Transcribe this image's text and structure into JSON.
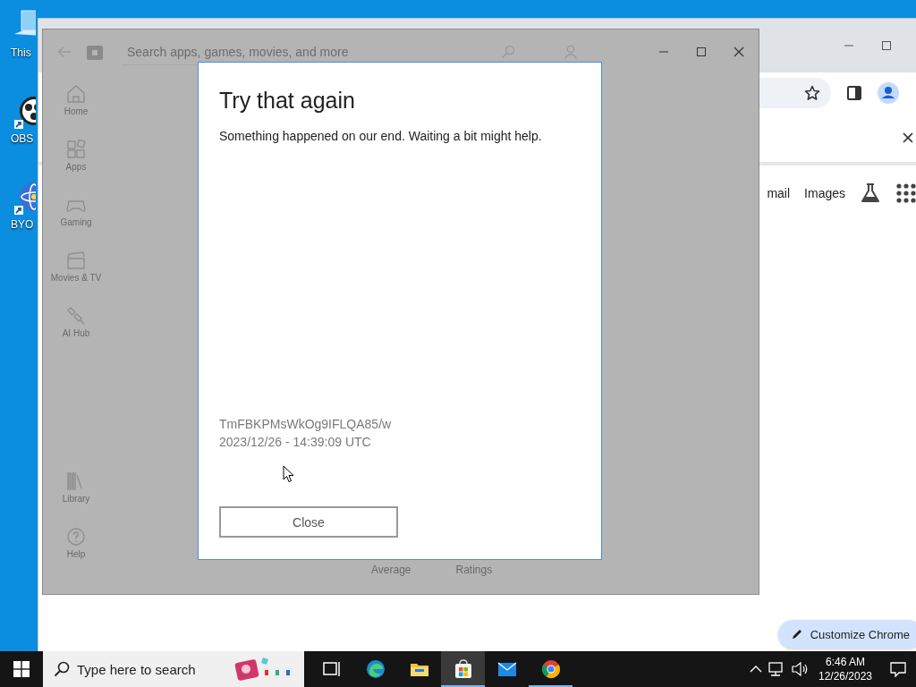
{
  "desktop_icons": [
    {
      "label": "This",
      "kind": "computer"
    },
    {
      "label": "OBS",
      "kind": "obs"
    },
    {
      "label": "BYO",
      "kind": "atom"
    }
  ],
  "browser_window": {
    "links": [
      "mail",
      "Images"
    ],
    "customize_button": "Customize Chrome"
  },
  "store_window": {
    "search": {
      "placeholder": "Search apps, games, movies, and more"
    },
    "nav_items": [
      {
        "label": "Home",
        "kind": "home"
      },
      {
        "label": "Apps",
        "kind": "apps"
      },
      {
        "label": "Gaming",
        "kind": "gaming"
      },
      {
        "label": "Movies & TV",
        "kind": "movies"
      },
      {
        "label": "AI Hub",
        "kind": "ai"
      }
    ],
    "footer_items": [
      {
        "label": "Library",
        "kind": "library"
      },
      {
        "label": "Help",
        "kind": "help"
      }
    ],
    "background_labels": [
      "Average",
      "Ratings"
    ]
  },
  "dialog": {
    "title": "Try that again",
    "message": "Something happened on our end. Waiting a bit might help.",
    "error_code": "TmFBKPMsWkOg9IFLQA85/w",
    "timestamp": "2023/12/26 - 14:39:09 UTC",
    "button": "Close"
  },
  "taskbar": {
    "search": {
      "placeholder": "Type here to search"
    },
    "apps": [
      {
        "kind": "taskview",
        "selected": false,
        "running": false
      },
      {
        "kind": "edge",
        "selected": false,
        "running": false
      },
      {
        "kind": "explorer",
        "selected": false,
        "running": false
      },
      {
        "kind": "store",
        "selected": true,
        "running": true
      },
      {
        "kind": "mail",
        "selected": false,
        "running": false
      },
      {
        "kind": "chrome",
        "selected": false,
        "running": true
      }
    ],
    "clock": {
      "time": "6:46 AM",
      "date": "12/26/2023"
    }
  }
}
